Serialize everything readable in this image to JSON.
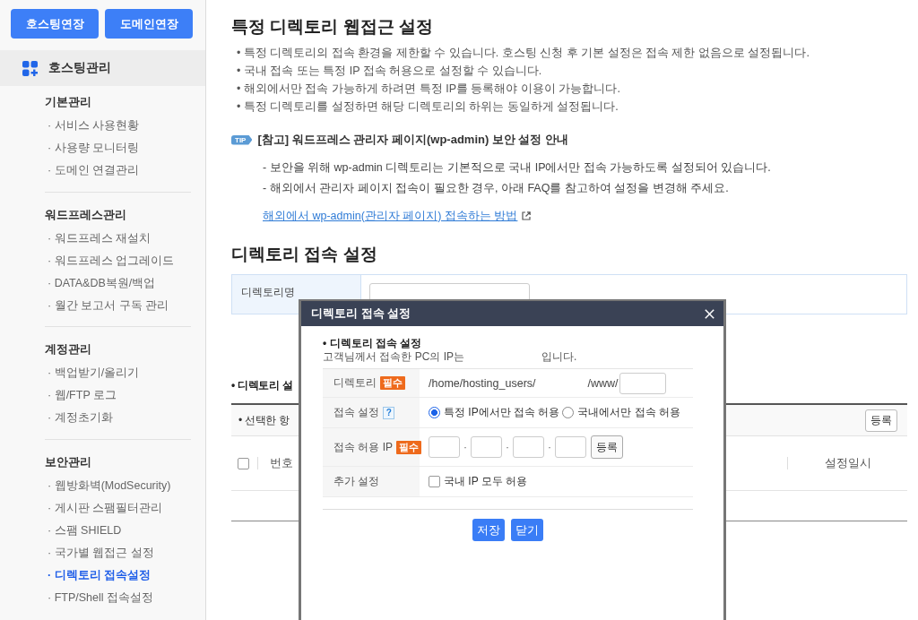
{
  "sidebar": {
    "buttons": [
      "호스팅연장",
      "도메인연장"
    ],
    "menu_title": "호스팅관리",
    "groups": [
      {
        "title": "기본관리",
        "items": [
          {
            "label": "· 서비스 사용현황",
            "selected": false
          },
          {
            "label": "· 사용량 모니터링",
            "selected": false
          },
          {
            "label": "· 도메인 연결관리",
            "selected": false
          }
        ]
      },
      {
        "title": "워드프레스관리",
        "items": [
          {
            "label": "· 워드프레스 재설치",
            "selected": false
          },
          {
            "label": "· 워드프레스 업그레이드",
            "selected": false
          },
          {
            "label": "· DATA&DB복원/백업",
            "selected": false
          },
          {
            "label": "· 월간 보고서 구독 관리",
            "selected": false
          }
        ]
      },
      {
        "title": "계정관리",
        "items": [
          {
            "label": "· 백업받기/올리기",
            "selected": false
          },
          {
            "label": "· 웹/FTP 로그",
            "selected": false
          },
          {
            "label": "· 계정초기화",
            "selected": false
          }
        ]
      },
      {
        "title": "보안관리",
        "items": [
          {
            "label": "· 웹방화벽(ModSecurity)",
            "selected": false
          },
          {
            "label": "· 게시판 스팸필터관리",
            "selected": false
          },
          {
            "label": "· 스팸 SHIELD",
            "selected": false
          },
          {
            "label": "· 국가별 웹접근 설정",
            "selected": false
          },
          {
            "label": "· 디렉토리 접속설정",
            "selected": true
          },
          {
            "label": "· FTP/Shell 접속설정",
            "selected": false
          }
        ]
      }
    ]
  },
  "page": {
    "title": "특정 디렉토리 웹접근 설정",
    "notes": [
      "• 특정 디렉토리의 접속 환경을 제한할 수 있습니다. 호스팅 신청 후 기본 설정은 접속 제한 없음으로 설정됩니다.",
      "• 국내 접속 또는 특정 IP 접속 허용으로 설정할 수 있습니다.",
      "• 해외에서만 접속 가능하게 하려면 특정 IP를 등록해야 이용이 가능합니다.",
      "• 특정 디렉토리를 설정하면 해당 디렉토리의 하위는 동일하게 설정됩니다."
    ],
    "tip": {
      "badge": "TIP",
      "title": "[참고] 워드프레스 관리자 페이지(wp-admin) 보안 설정 안내",
      "lines": [
        "- 보안을 위해 wp-admin 디렉토리는 기본적으로 국내 IP에서만 접속 가능하도록 설정되어 있습니다.",
        "- 해외에서 관리자 페이지 접속이 필요한 경우, 아래 FAQ를 참고하여 설정을 변경해 주세요."
      ],
      "link": "해외에서 wp-admin(관리자 페이지) 접속하는 방법"
    },
    "section_title": "디렉토리 접속 설정",
    "name_field": {
      "label": "디렉토리명"
    },
    "list_title": "• 디렉토리 설",
    "list": {
      "toolbar_text": "• 선택한 항",
      "button": "등록",
      "select_all": {
        "checked": false
      },
      "columns": [
        "번호",
        "설정일시"
      ]
    }
  },
  "dialog": {
    "title": "디렉토리 접속 설정",
    "section_title": "• 디렉토리 접속 설정",
    "ip_notice": [
      "고객님께서 접속한 PC의 IP는",
      "입니다."
    ],
    "rows": [
      {
        "kind": "path",
        "label": "디렉토리",
        "required": "필수",
        "prefix": "/home/hosting_users/",
        "suffix": "/www/"
      },
      {
        "kind": "radios",
        "label": "접속 설정",
        "help": "?",
        "options": [
          {
            "label": "특정 IP에서만 접속 허용",
            "selected": true
          },
          {
            "label": "국내에서만 접속 허용",
            "selected": false
          }
        ]
      },
      {
        "kind": "ip",
        "label": "접속 허용 IP",
        "required": "필수",
        "separators": [
          "·",
          "·",
          "·"
        ],
        "button": "등록"
      },
      {
        "kind": "checkbox",
        "label": "추가 설정",
        "option": {
          "label": "국내 IP 모두 허용",
          "checked": false
        }
      }
    ],
    "buttons": [
      "저장",
      "닫기"
    ]
  }
}
